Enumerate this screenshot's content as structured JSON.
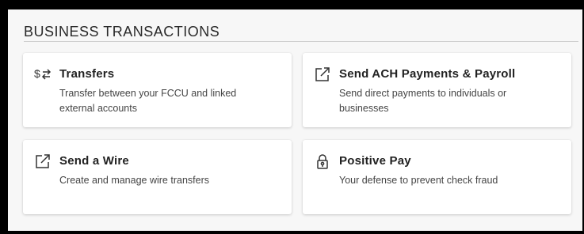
{
  "section": {
    "title": "BUSINESS TRANSACTIONS"
  },
  "cards": [
    {
      "icon": "dollar-transfer-icon",
      "title": "Transfers",
      "description": "Transfer between your FCCU and linked external accounts"
    },
    {
      "icon": "external-link-icon",
      "title": "Send ACH Payments & Payroll",
      "description": "Send direct payments to individuals or businesses"
    },
    {
      "icon": "external-link-icon",
      "title": "Send a Wire",
      "description": "Create and manage wire transfers"
    },
    {
      "icon": "lock-icon",
      "title": "Positive Pay",
      "description": "Your defense to prevent check fraud"
    }
  ]
}
